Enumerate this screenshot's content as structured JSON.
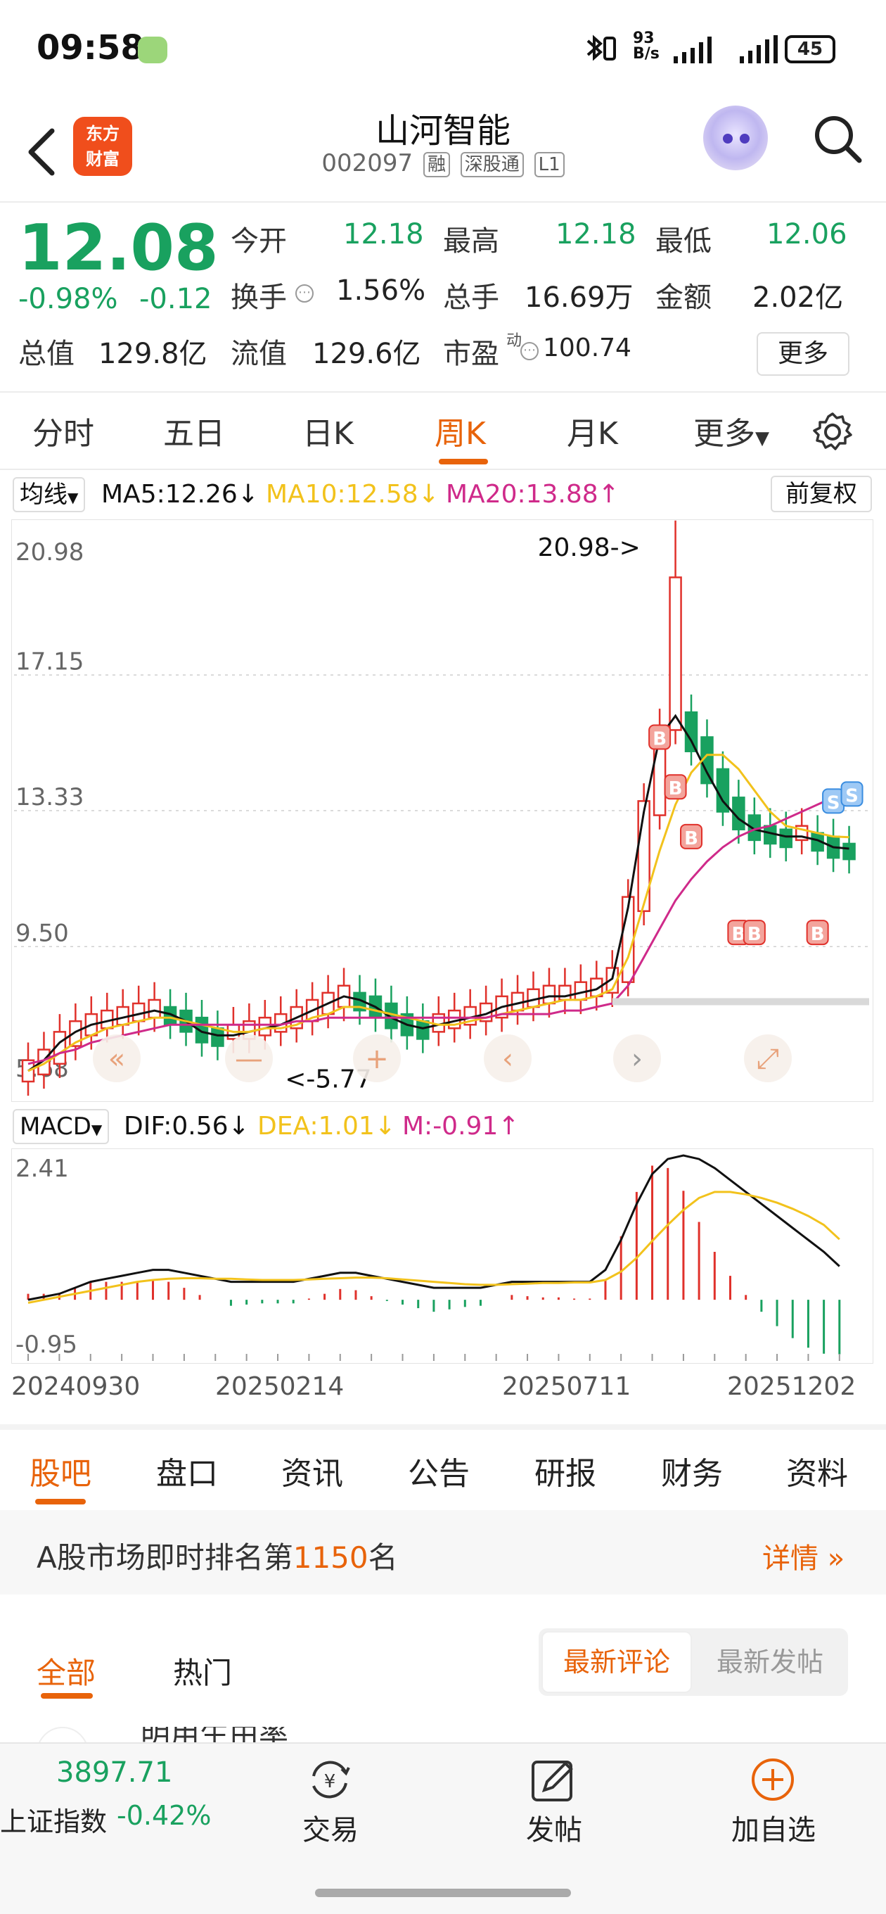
{
  "status_bar": {
    "time": "09:58",
    "net_speed_top": "93",
    "net_speed_bottom": "B/s",
    "battery": "45"
  },
  "header": {
    "logo_line1": "东方",
    "logo_line2": "财富",
    "name": "山河智能",
    "code": "002097",
    "tags": [
      "融",
      "深股通",
      "L1"
    ]
  },
  "quote": {
    "price": "12.08",
    "change_pct": "-0.98%",
    "change": "-0.12",
    "rows": [
      [
        {
          "label": "今开",
          "value": "12.18"
        },
        {
          "label": "最高",
          "value": "12.18"
        },
        {
          "label": "最低",
          "value": "12.06"
        }
      ],
      [
        {
          "label": "换手",
          "value": "1.56%"
        },
        {
          "label": "总手",
          "value": "16.69万"
        },
        {
          "label": "金额",
          "value": "2.02亿"
        }
      ],
      [
        {
          "label": "总值",
          "value": "129.8亿"
        },
        {
          "label": "流值",
          "value": "129.6亿"
        },
        {
          "label": "市盈",
          "value": "100.74",
          "sup": "动"
        }
      ]
    ],
    "more_label": "更多"
  },
  "period_tabs": [
    "分时",
    "五日",
    "日K",
    "周K",
    "月K",
    "更多"
  ],
  "active_period": "周K",
  "ma_legend": {
    "selector": "均线",
    "ma5": "MA5:12.26↓",
    "ma10": "MA10:12.58↓",
    "ma20": "MA20:13.88↑",
    "adjust": "前复权"
  },
  "macd_legend": {
    "selector": "MACD",
    "dif": "DIF:0.56↓",
    "dea": "DEA:1.01↓",
    "m": "M:-0.91↑"
  },
  "colors": {
    "up": "#e0312b",
    "down": "#19a15f",
    "ma5": "#111111",
    "ma10": "#f2c21c",
    "ma20": "#cf2a8a",
    "accent": "#e8630a"
  },
  "chart_data": [
    {
      "type": "candlestick",
      "title": "",
      "period": "weekly",
      "y_ticks": [
        "20.98",
        "17.15",
        "13.33",
        "9.50",
        "5.68"
      ],
      "ylim": [
        5.68,
        20.98
      ],
      "annotations": [
        {
          "text": "20.98->",
          "value": 20.98
        },
        {
          "text": "<-5.77",
          "value": 5.77
        }
      ],
      "buy_signals": 6,
      "sell_signals": 2,
      "series": [
        {
          "name": "MA5",
          "values": [
            6.0,
            6.3,
            6.8,
            7.1,
            7.3,
            7.4,
            7.5,
            7.6,
            7.7,
            7.6,
            7.4,
            7.1,
            7.0,
            7.0,
            7.1,
            7.2,
            7.3,
            7.5,
            7.7,
            7.9,
            8.1,
            8.0,
            7.8,
            7.5,
            7.3,
            7.2,
            7.3,
            7.4,
            7.5,
            7.6,
            7.8,
            7.9,
            8.0,
            8.1,
            8.1,
            8.2,
            8.3,
            8.6,
            10.6,
            13.3,
            15.4,
            16.0,
            15.3,
            14.4,
            13.6,
            13.1,
            12.8,
            12.7,
            12.6,
            12.6,
            12.5,
            12.3,
            12.26
          ]
        },
        {
          "name": "MA10",
          "values": [
            6.0,
            6.2,
            6.5,
            6.8,
            7.0,
            7.2,
            7.3,
            7.4,
            7.5,
            7.5,
            7.4,
            7.3,
            7.2,
            7.1,
            7.1,
            7.2,
            7.2,
            7.3,
            7.5,
            7.6,
            7.8,
            7.8,
            7.7,
            7.6,
            7.5,
            7.4,
            7.3,
            7.3,
            7.4,
            7.5,
            7.6,
            7.7,
            7.8,
            7.9,
            8.0,
            8.0,
            8.1,
            8.3,
            9.2,
            10.7,
            12.2,
            13.5,
            14.4,
            14.9,
            14.9,
            14.5,
            13.9,
            13.3,
            12.9,
            12.8,
            12.7,
            12.6,
            12.58
          ]
        },
        {
          "name": "MA20",
          "values": [
            6.2,
            6.3,
            6.5,
            6.6,
            6.8,
            6.9,
            7.0,
            7.1,
            7.2,
            7.3,
            7.3,
            7.3,
            7.3,
            7.3,
            7.3,
            7.3,
            7.3,
            7.4,
            7.4,
            7.5,
            7.5,
            7.5,
            7.5,
            7.5,
            7.5,
            7.5,
            7.5,
            7.5,
            7.5,
            7.5,
            7.6,
            7.6,
            7.6,
            7.6,
            7.7,
            7.7,
            7.8,
            7.9,
            8.4,
            9.2,
            10.0,
            10.8,
            11.4,
            11.9,
            12.3,
            12.6,
            12.8,
            12.9,
            13.1,
            13.3,
            13.5,
            13.7,
            13.88
          ]
        }
      ]
    },
    {
      "type": "macd",
      "title": "",
      "y_ticks": [
        "2.41",
        "-0.95"
      ],
      "ylim": [
        -0.95,
        2.41
      ],
      "x_labels": [
        "20240930",
        "20250214",
        "20250711",
        "20251202"
      ],
      "series": [
        {
          "name": "DIF",
          "values": [
            0.0,
            0.05,
            0.1,
            0.2,
            0.3,
            0.35,
            0.4,
            0.45,
            0.5,
            0.5,
            0.45,
            0.4,
            0.35,
            0.3,
            0.3,
            0.3,
            0.3,
            0.3,
            0.35,
            0.4,
            0.45,
            0.45,
            0.4,
            0.35,
            0.3,
            0.25,
            0.2,
            0.2,
            0.2,
            0.2,
            0.25,
            0.3,
            0.3,
            0.3,
            0.3,
            0.3,
            0.3,
            0.5,
            1.0,
            1.6,
            2.1,
            2.35,
            2.41,
            2.35,
            2.2,
            2.0,
            1.8,
            1.6,
            1.4,
            1.2,
            1.0,
            0.8,
            0.56
          ]
        },
        {
          "name": "DEA",
          "values": [
            -0.05,
            0.0,
            0.05,
            0.1,
            0.15,
            0.2,
            0.25,
            0.3,
            0.33,
            0.35,
            0.36,
            0.36,
            0.35,
            0.35,
            0.34,
            0.33,
            0.33,
            0.33,
            0.34,
            0.35,
            0.36,
            0.37,
            0.37,
            0.36,
            0.34,
            0.32,
            0.3,
            0.28,
            0.26,
            0.25,
            0.25,
            0.26,
            0.27,
            0.28,
            0.28,
            0.29,
            0.29,
            0.33,
            0.47,
            0.7,
            0.98,
            1.25,
            1.5,
            1.7,
            1.8,
            1.8,
            1.76,
            1.7,
            1.62,
            1.52,
            1.4,
            1.25,
            1.01
          ]
        }
      ],
      "histogram": [
        0.1,
        0.1,
        0.1,
        0.2,
        0.3,
        0.3,
        0.3,
        0.3,
        0.34,
        0.3,
        0.2,
        0.08,
        0.0,
        -0.1,
        -0.08,
        -0.06,
        -0.06,
        -0.06,
        0.02,
        0.1,
        0.18,
        0.16,
        0.06,
        -0.02,
        -0.08,
        -0.14,
        -0.2,
        -0.16,
        -0.12,
        -0.1,
        0.0,
        0.08,
        0.06,
        0.04,
        0.04,
        0.02,
        0.02,
        0.34,
        1.06,
        1.8,
        2.24,
        2.2,
        1.82,
        1.3,
        0.8,
        0.4,
        0.08,
        -0.2,
        -0.44,
        -0.64,
        -0.8,
        -0.9,
        -0.91
      ]
    }
  ],
  "news_tabs": [
    "股吧",
    "盘口",
    "资讯",
    "公告",
    "研报",
    "财务",
    "资料"
  ],
  "rank": {
    "prefix": "A股市场即时排名第",
    "number": "1150",
    "suffix": "名",
    "detail": "详情"
  },
  "sub_tabs": [
    "全部",
    "热门"
  ],
  "sort_options": [
    "最新评论",
    "最新发帖"
  ],
  "partial_text": "明用生由率",
  "bottom_nav": {
    "index_value": "3897.71",
    "index_name": "上证指数",
    "index_change": "-0.42%",
    "trade": "交易",
    "post": "发帖",
    "watch": "加自选"
  }
}
